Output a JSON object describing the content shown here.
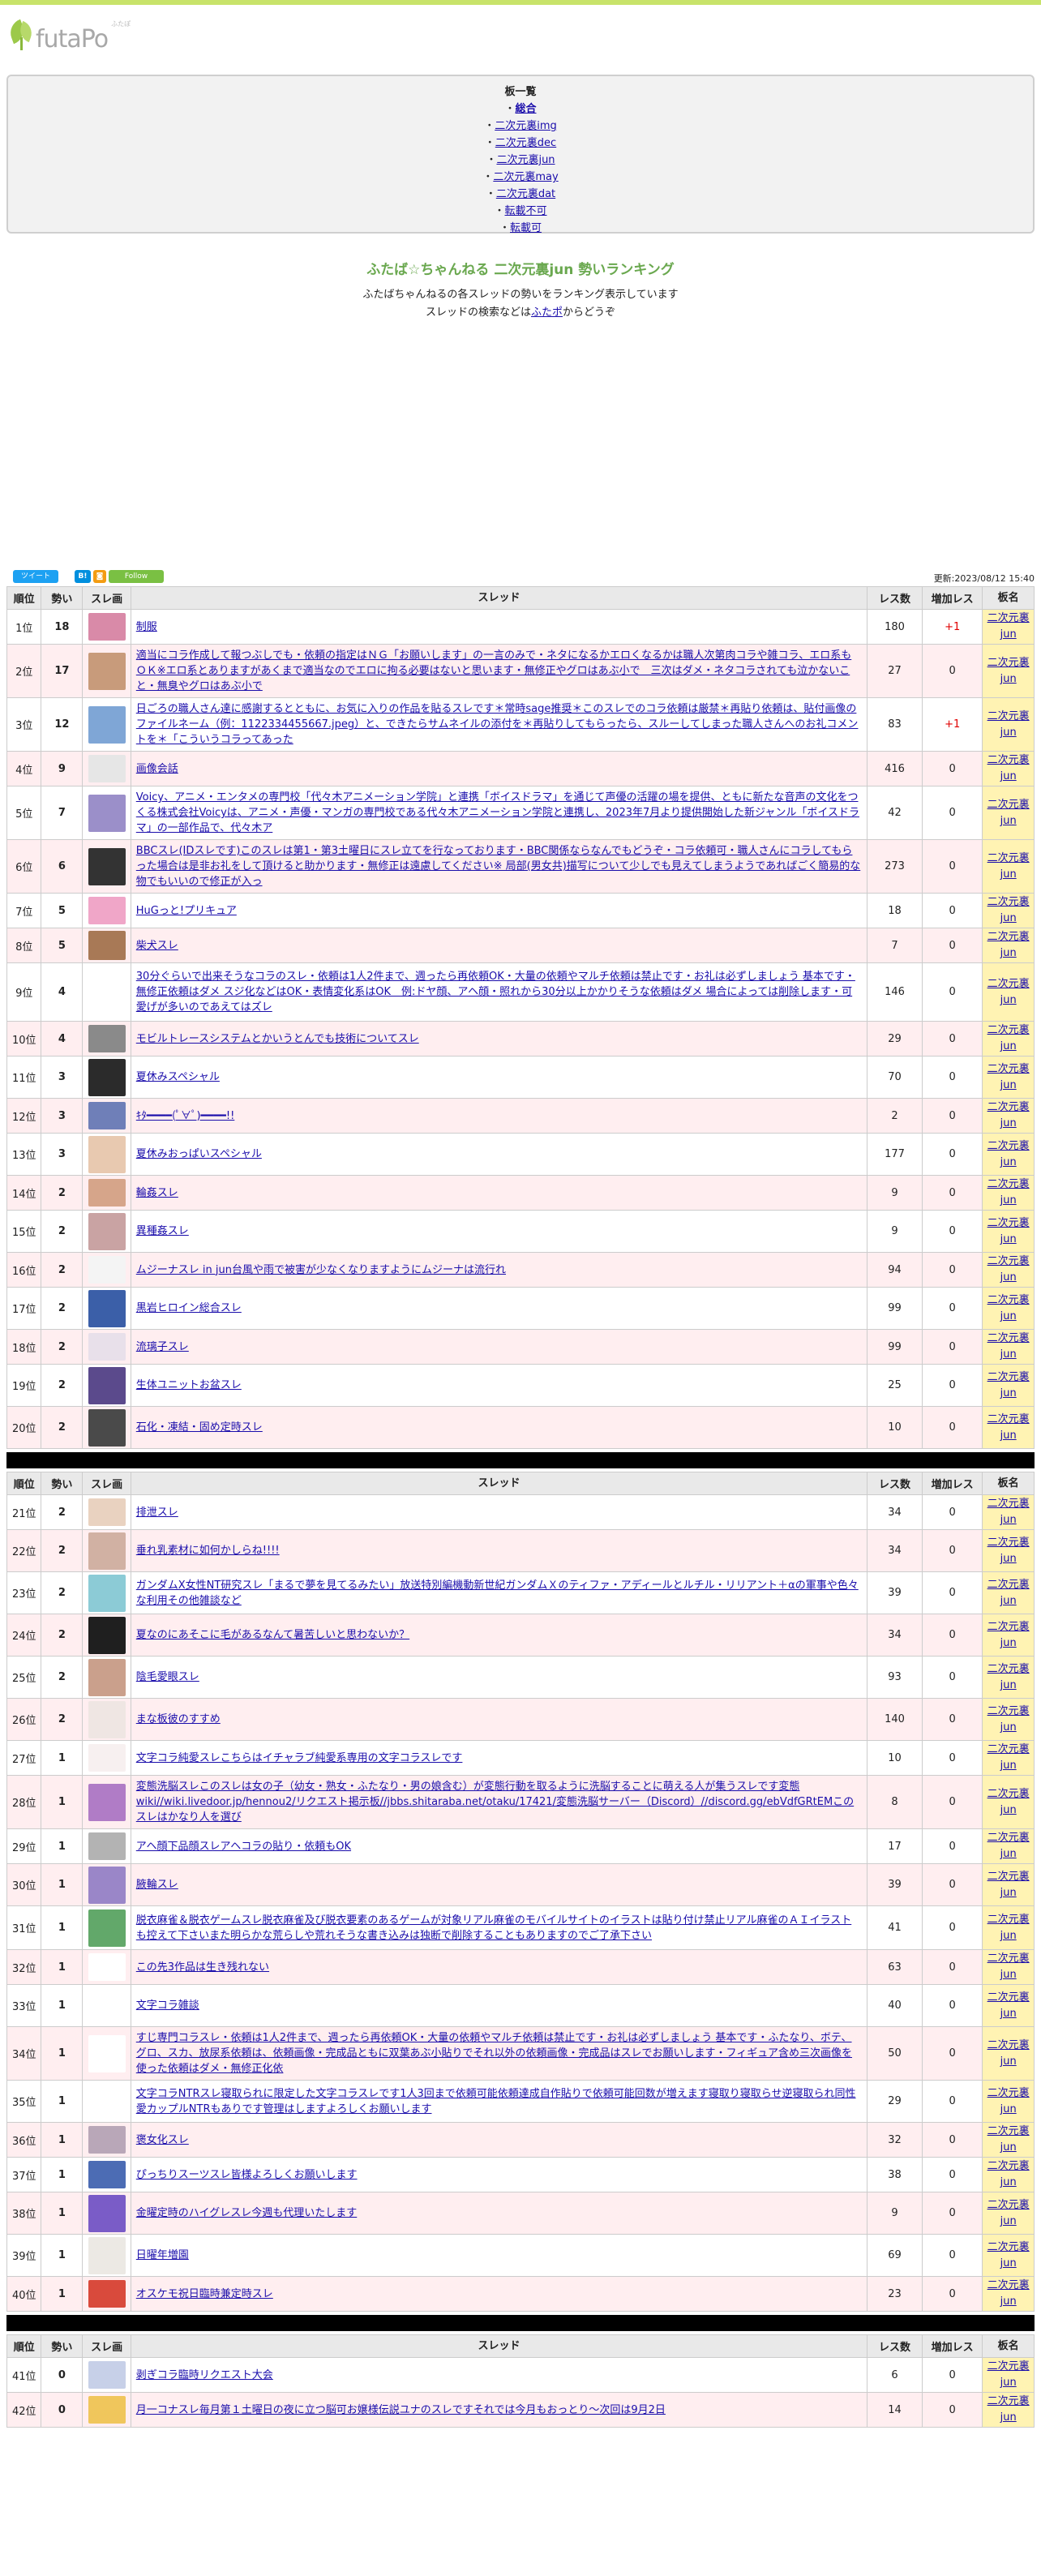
{
  "logo": {
    "text": "futaPo",
    "sub": "ふたぽ"
  },
  "boards": {
    "heading": "板一覧",
    "items": [
      "総合",
      "二次元裏img",
      "二次元裏dec",
      "二次元裏jun",
      "二次元裏may",
      "二次元裏dat",
      "転載不可",
      "転載可"
    ]
  },
  "intro": {
    "title": "ふたば☆ちゃんねる 二次元裏jun 勢いランキング",
    "line1": "ふたばちゃんねるの各スレッドの勢いをランキング表示しています",
    "line2_pre": "スレッドの検索などは",
    "line2_link": "ふたポ",
    "line2_post": "からどうぞ"
  },
  "social": {
    "tweet": "ツイート",
    "hatena": "B!",
    "rss": "◙",
    "follow": "Follow",
    "updated": "更新:2023/08/12 15:40"
  },
  "table_headers": {
    "rank": "順位",
    "ikioi": "勢い",
    "img": "スレ画",
    "title": "スレッド",
    "res": "レス数",
    "inc": "増加レス",
    "board": "板名"
  },
  "rows": [
    {
      "rank": "1位",
      "ikioi": "18",
      "title": "制服",
      "res": "180",
      "inc": "+1",
      "board": "二次元裏jun",
      "thumb": "#d98aa8"
    },
    {
      "rank": "2位",
      "ikioi": "17",
      "title": "適当にコラ作成して報つぶしでも・依頼の指定はＮＧ「お願いします」の一言のみで・ネタになるかエロくなるかは職人次第肉コラや雑コラ、エロ系もＯＫ※エロ系とありますがあくまで適当なのでエロに拘る必要はないと思います・無修正やグロはあぶ小で　三次はダメ・ネタコラされても泣かないこと・無臭やグロはあぶ小で",
      "res": "27",
      "inc": "0",
      "board": "二次元裏jun",
      "thumb": "#c89b7b"
    },
    {
      "rank": "3位",
      "ikioi": "12",
      "title": "日ごろの職人さん達に感謝するとともに、お気に入りの作品を貼るスレです＊常時sage推奨＊このスレでのコラ依頼は厳禁＊再貼り依頼は、貼付画像のファイルネーム（例：1122334455667.jpeg）と、できたらサムネイルの添付を＊再貼りしてもらったら、スルーしてしまった職人さんへのお礼コメントを＊「こういうコラってあった",
      "res": "83",
      "inc": "+1",
      "board": "二次元裏jun",
      "thumb": "#7fa6d6"
    },
    {
      "rank": "4位",
      "ikioi": "9",
      "title": "画像会話",
      "res": "416",
      "inc": "0",
      "board": "二次元裏jun",
      "thumb": "#e6e6e6"
    },
    {
      "rank": "5位",
      "ikioi": "7",
      "title": "Voicy、アニメ・エンタメの専門校「代々木アニメーション学院」と連携「ボイスドラマ」を通じて声優の活躍の場を提供、ともに新たな音声の文化をつくる株式会社Voicyは、アニメ・声優・マンガの専門校である代々木アニメーション学院と連携し、2023年7月より提供開始した新ジャンル「ボイスドラマ」の一部作品で、代々木ア",
      "res": "42",
      "inc": "0",
      "board": "二次元裏jun",
      "thumb": "#9b8fc9"
    },
    {
      "rank": "6位",
      "ikioi": "6",
      "title": "BBCスレ(IDスレです)このスレは第1・第3土曜日にスレ立てを行なっております・BBC関係ならなんでもどうぞ・コラ依頼可・職人さんにコラしてもらった場合は是非お礼をして頂けると助かります・無修正は遠慮してください※ 局部(男女共)描写について少しでも見えてしまうようであればごく簡易的な物でもいいので修正が入っ",
      "res": "273",
      "inc": "0",
      "board": "二次元裏jun",
      "thumb": "#333333"
    },
    {
      "rank": "7位",
      "ikioi": "5",
      "title": "HuGっと!プリキュア",
      "res": "18",
      "inc": "0",
      "board": "二次元裏jun",
      "thumb": "#f0a6c8"
    },
    {
      "rank": "8位",
      "ikioi": "5",
      "title": "柴犬スレ",
      "res": "7",
      "inc": "0",
      "board": "二次元裏jun",
      "thumb": "#a87956"
    },
    {
      "rank": "9位",
      "ikioi": "4",
      "title": "30分ぐらいで出来そうなコラのスレ・依頼は1人2件まで、週ったら再依頼OK・大量の依頼やマルチ依頼は禁止です・お礼は必ずしましょう 基本です・無修正依頼はダメ スジ化などはOK・表情変化系はOK　例:ドヤ顔、アヘ顔・照れから30分以上かかりそうな依頼はダメ 場合によっては削除します・可愛げが多いのであえてはズレ",
      "res": "146",
      "inc": "0",
      "board": "二次元裏jun",
      "thumb": "#ffffff"
    },
    {
      "rank": "10位",
      "ikioi": "4",
      "title": "モビルトレースシステムとかいうとんでも技術についてスレ",
      "res": "29",
      "inc": "0",
      "board": "二次元裏jun",
      "thumb": "#8a8a8a"
    },
    {
      "rank": "11位",
      "ikioi": "3",
      "title": "夏休みスペシャル",
      "res": "70",
      "inc": "0",
      "board": "二次元裏jun",
      "thumb": "#2b2b2b"
    },
    {
      "rank": "12位",
      "ikioi": "3",
      "title": "ｷﾀ━━━━(ﾟ∀ﾟ)━━━━!!",
      "res": "2",
      "inc": "0",
      "board": "二次元裏jun",
      "thumb": "#6f7fb8"
    },
    {
      "rank": "13位",
      "ikioi": "3",
      "title": "夏休みおっぱいスペシャル",
      "res": "177",
      "inc": "0",
      "board": "二次元裏jun",
      "thumb": "#e8c9b0"
    },
    {
      "rank": "14位",
      "ikioi": "2",
      "title": "輪姦スレ",
      "res": "9",
      "inc": "0",
      "board": "二次元裏jun",
      "thumb": "#d6a58a"
    },
    {
      "rank": "15位",
      "ikioi": "2",
      "title": "異種姦スレ",
      "res": "9",
      "inc": "0",
      "board": "二次元裏jun",
      "thumb": "#c9a3a3"
    },
    {
      "rank": "16位",
      "ikioi": "2",
      "title": "ムジーナスレ in jun台風や雨で被害が少なくなりますようにムジーナは流行れ",
      "res": "94",
      "inc": "0",
      "board": "二次元裏jun",
      "thumb": "#f4f4f4"
    },
    {
      "rank": "17位",
      "ikioi": "2",
      "title": "黒岩ヒロイン総合スレ",
      "res": "99",
      "inc": "0",
      "board": "二次元裏jun",
      "thumb": "#3b5fa8"
    },
    {
      "rank": "18位",
      "ikioi": "2",
      "title": "流璃子スレ",
      "res": "99",
      "inc": "0",
      "board": "二次元裏jun",
      "thumb": "#e8e0ea"
    },
    {
      "rank": "19位",
      "ikioi": "2",
      "title": "生体ユニットお盆スレ",
      "res": "25",
      "inc": "0",
      "board": "二次元裏jun",
      "thumb": "#5b4a8c"
    },
    {
      "rank": "20位",
      "ikioi": "2",
      "title": "石化・凍結・固め定時スレ",
      "res": "10",
      "inc": "0",
      "board": "二次元裏jun",
      "thumb": "#4a4a4a"
    },
    {
      "rank": "21位",
      "ikioi": "2",
      "title": "排泄スレ",
      "res": "34",
      "inc": "0",
      "board": "二次元裏jun",
      "thumb": "#e9d2c0"
    },
    {
      "rank": "22位",
      "ikioi": "2",
      "title": "垂れ乳素材に如何かしらね!!!!",
      "res": "34",
      "inc": "0",
      "board": "二次元裏jun",
      "thumb": "#d1b1a3"
    },
    {
      "rank": "23位",
      "ikioi": "2",
      "title": "ガンダムX女性NT研究スレ「まるで夢を見てるみたい」放送特別編機動新世紀ガンダムＸのティファ・アディールとルチル・リリアント＋αの軍事や色々な利用その他雑談など",
      "res": "39",
      "inc": "0",
      "board": "二次元裏jun",
      "thumb": "#8ccbd6"
    },
    {
      "rank": "24位",
      "ikioi": "2",
      "title": "夏なのにあそこに毛があるなんて暑苦しいと思わないか？",
      "res": "34",
      "inc": "0",
      "board": "二次元裏jun",
      "thumb": "#1f1f1f"
    },
    {
      "rank": "25位",
      "ikioi": "2",
      "title": "陰毛愛眼スレ",
      "res": "93",
      "inc": "0",
      "board": "二次元裏jun",
      "thumb": "#caa08c"
    },
    {
      "rank": "26位",
      "ikioi": "2",
      "title": "まな板彼のすすめ",
      "res": "140",
      "inc": "0",
      "board": "二次元裏jun",
      "thumb": "#efe6e3"
    },
    {
      "rank": "27位",
      "ikioi": "1",
      "title": "文字コラ純愛スレこちらはイチャラブ純愛系専用の文字コラスレです",
      "res": "10",
      "inc": "0",
      "board": "二次元裏jun",
      "thumb": "#f7f0f0"
    },
    {
      "rank": "28位",
      "ikioi": "1",
      "title": "変態洗脳スレこのスレは女の子（幼女・熟女・ふたなり・男の娘含む）が変態行動を取るように洗脳することに萌える人が集うスレです変態wiki//wiki.livedoor.jp/hennou2/リクエスト掲示板//jbbs.shitaraba.net/otaku/17421/変態洗脳サーバー（Discord）//discord.gg/ebVdfGRtEMこのスレはかなり人を選び",
      "res": "8",
      "inc": "0",
      "board": "二次元裏jun",
      "thumb": "#b07cc6"
    },
    {
      "rank": "29位",
      "ikioi": "1",
      "title": "アヘ顔下品顔スレアヘコラの貼り・依頼もOK",
      "res": "17",
      "inc": "0",
      "board": "二次元裏jun",
      "thumb": "#b3b3b3"
    },
    {
      "rank": "30位",
      "ikioi": "1",
      "title": "腋輪スレ",
      "res": "39",
      "inc": "0",
      "board": "二次元裏jun",
      "thumb": "#9a86c8"
    },
    {
      "rank": "31位",
      "ikioi": "1",
      "title": "脱衣麻雀＆脱衣ゲームスレ脱衣麻雀及び脱衣要素のあるゲームが対象リアル麻雀のモバイルサイトのイラストは貼り付け禁止リアル麻雀のＡＩイラストも控えて下さいまた明らかな荒らしや荒れそうな書き込みは独断で削除することもありますのでご了承下さい",
      "res": "41",
      "inc": "0",
      "board": "二次元裏jun",
      "thumb": "#62a86a"
    },
    {
      "rank": "32位",
      "ikioi": "1",
      "title": "この先3作品は生き残れない",
      "res": "63",
      "inc": "0",
      "board": "二次元裏jun",
      "thumb": "#ffffff"
    },
    {
      "rank": "33位",
      "ikioi": "1",
      "title": "文字コラ雑談",
      "res": "40",
      "inc": "0",
      "board": "二次元裏jun",
      "thumb": "#ffffff"
    },
    {
      "rank": "34位",
      "ikioi": "1",
      "title": "すじ専門コラスレ・依頼は1人2件まで、週ったら再依頼OK・大量の依頼やマルチ依頼は禁止です・お礼は必ずしましょう 基本です・ふたなり、ボテ、グロ、スカ、放尿系依頼は、依頼画像・完成品ともに双葉あぶ小貼りでそれ以外の依頼画像・完成品はスレでお願いします・フィギュア含め三次画像を使った依頼はダメ・無修正化依",
      "res": "50",
      "inc": "0",
      "board": "二次元裏jun",
      "thumb": "#ffffff"
    },
    {
      "rank": "35位",
      "ikioi": "1",
      "title": "文字コラNTRスレ寝取られに限定した文字コラスレです1人3回まで依頼可能依頼達成自作貼りで依頼可能回数が増えます寝取り寝取らせ逆寝取られ同性愛カップルNTRもありです管理はしますよろしくお願いします",
      "res": "29",
      "inc": "0",
      "board": "二次元裏jun",
      "thumb": "#ffffff"
    },
    {
      "rank": "36位",
      "ikioi": "1",
      "title": "褒女化スレ",
      "res": "32",
      "inc": "0",
      "board": "二次元裏jun",
      "thumb": "#b9a7b8"
    },
    {
      "rank": "37位",
      "ikioi": "1",
      "title": "ぴっちりスーツスレ皆様よろしくお願いします",
      "res": "38",
      "inc": "0",
      "board": "二次元裏jun",
      "thumb": "#4c6cb4"
    },
    {
      "rank": "38位",
      "ikioi": "1",
      "title": "金曜定時のハイグレスレ今週も代理いたします",
      "res": "9",
      "inc": "0",
      "board": "二次元裏jun",
      "thumb": "#7a5cc7"
    },
    {
      "rank": "39位",
      "ikioi": "1",
      "title": "日曜年増園",
      "res": "69",
      "inc": "0",
      "board": "二次元裏jun",
      "thumb": "#ece9e4"
    },
    {
      "rank": "40位",
      "ikioi": "1",
      "title": "オスケモ祝日臨時兼定時スレ",
      "res": "23",
      "inc": "0",
      "board": "二次元裏jun",
      "thumb": "#d94a3c"
    },
    {
      "rank": "41位",
      "ikioi": "0",
      "title": "剥ぎコラ臨時リクエスト大会",
      "res": "6",
      "inc": "0",
      "board": "二次元裏jun",
      "thumb": "#c7d0e8"
    },
    {
      "rank": "42位",
      "ikioi": "0",
      "title": "月一コナスレ毎月第１土曜日の夜に立つ脳可お嬢様伝説ユナのスレですそれでは今月もおっとり〜次回は9月2日",
      "res": "14",
      "inc": "0",
      "board": "二次元裏jun",
      "thumb": "#f0c65c"
    }
  ]
}
